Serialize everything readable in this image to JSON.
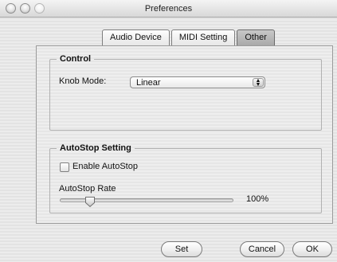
{
  "window": {
    "title": "Preferences"
  },
  "tabs": [
    {
      "label": "Audio Device",
      "active": false
    },
    {
      "label": "MIDI Setting",
      "active": false
    },
    {
      "label": "Other",
      "active": true
    }
  ],
  "control": {
    "legend": "Control",
    "knob_mode_label": "Knob Mode:",
    "knob_mode_value": "Linear"
  },
  "autostop": {
    "legend": "AutoStop Setting",
    "enable_label": "Enable AutoStop",
    "enable_checked": false,
    "rate_label": "AutoStop Rate",
    "rate_value_text": "100%",
    "rate_position_fraction": 0.18
  },
  "buttons": {
    "set": "Set",
    "cancel": "Cancel",
    "ok": "OK"
  }
}
